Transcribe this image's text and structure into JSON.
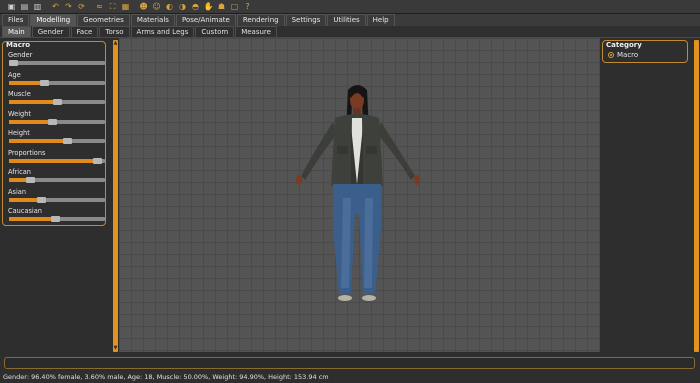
{
  "toolbar": {
    "icons": [
      "undo-history-icon",
      "save-icon",
      "export-icon",
      "undo-icon",
      "redo-icon",
      "reset-icon",
      "wireframe-icon",
      "skin-icon",
      "checker-icon",
      "front-view-icon",
      "back-view-icon",
      "left-view-icon",
      "right-view-icon",
      "top-view-icon",
      "bottom-view-icon",
      "pose-icon",
      "camera-icon",
      "help-icon"
    ],
    "glyphs": [
      "▣",
      "▤",
      "▥",
      "↶",
      "↷",
      "⟳",
      "≈",
      "⛶",
      "▦",
      "☻",
      "☺",
      "◐",
      "◑",
      "◓",
      "✋",
      "☗",
      "▢",
      "?"
    ]
  },
  "menu": {
    "tabs": [
      "Files",
      "Modelling",
      "Geometries",
      "Materials",
      "Pose/Animate",
      "Rendering",
      "Settings",
      "Utilities",
      "Help"
    ],
    "active": "Modelling"
  },
  "subtabs": {
    "tabs": [
      "Main",
      "Gender",
      "Face",
      "Torso",
      "Arms and Legs",
      "Custom",
      "Measure"
    ],
    "active": "Main"
  },
  "macro": {
    "title": "Macro",
    "sliders": [
      {
        "label": "Gender",
        "value": 0.04
      },
      {
        "label": "Age",
        "value": 0.36
      },
      {
        "label": "Muscle",
        "value": 0.5
      },
      {
        "label": "Weight",
        "value": 0.45
      },
      {
        "label": "Height",
        "value": 0.6
      },
      {
        "label": "Proportions",
        "value": 0.92
      },
      {
        "label": "African",
        "value": 0.22
      },
      {
        "label": "Asian",
        "value": 0.33
      },
      {
        "label": "Caucasian",
        "value": 0.48
      }
    ]
  },
  "category": {
    "title": "Category",
    "option": "Macro"
  },
  "status_text": "Gender: 96.40% female, 3.60% male, Age: 18, Muscle: 50.00%, Weight: 94.90%, Height: 153.94 cm",
  "colors": {
    "accent": "#e08a1e",
    "panel_border": "#c28a2e",
    "viewport_bg": "#545454"
  }
}
